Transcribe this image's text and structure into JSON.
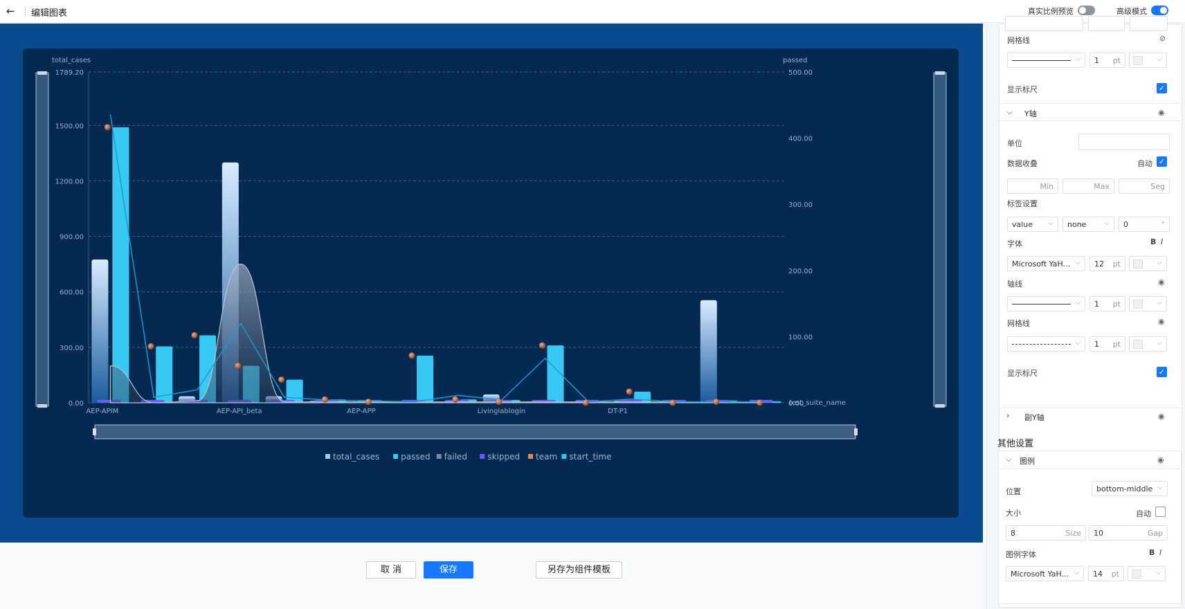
{
  "topbar": {
    "back_icon": "←",
    "title": "编辑图表",
    "real_ratio_label": "真实比例预览",
    "advanced_label": "高级模式",
    "real_ratio_on": false,
    "advanced_on": true
  },
  "chart_data": {
    "type": "bar",
    "categories": [
      "AEP-APIM",
      "",
      "",
      "AEP-API_beta",
      "",
      "",
      "AEP-APP",
      "",
      "",
      "Livinglablogin",
      "",
      "",
      "DT-P1",
      "",
      "",
      ""
    ],
    "x_tick_labels": [
      "AEP-APIM",
      "AEP-API_beta",
      "AEP-APP",
      "Livinglablogin",
      "DT-P1"
    ],
    "x_axis_name": "test_suite_name",
    "y_axis_name": "total_cases",
    "y2_axis_name": "passed",
    "ylim": [
      0,
      1789.2
    ],
    "y_ticks": [
      "0.00",
      "300.00",
      "600.00",
      "900.00",
      "1200.00",
      "1500.00",
      "1789.20"
    ],
    "y2lim": [
      0,
      500
    ],
    "y2_ticks": [
      "0.00",
      "100.00",
      "200.00",
      "300.00",
      "400.00",
      "500.00"
    ],
    "series": [
      {
        "name": "total_cases",
        "values": [
          775,
          0,
          35,
          1300,
          35,
          10,
          5,
          10,
          5,
          45,
          5,
          5,
          10,
          5,
          555,
          0
        ]
      },
      {
        "name": "passed",
        "values": [
          1490,
          305,
          365,
          200,
          125,
          18,
          5,
          255,
          18,
          15,
          310,
          5,
          60,
          5,
          12,
          8
        ]
      },
      {
        "name": "failed",
        "values": [
          200,
          0,
          10,
          750,
          5,
          5,
          5,
          5,
          5,
          5,
          5,
          5,
          5,
          5,
          5,
          5
        ]
      },
      {
        "name": "skipped",
        "values": [
          8,
          8,
          8,
          8,
          8,
          8,
          8,
          8,
          8,
          8,
          8,
          8,
          8,
          8,
          8,
          8
        ]
      },
      {
        "name": "team",
        "values": [
          1490,
          305,
          365,
          200,
          125,
          18,
          5,
          255,
          18,
          5,
          310,
          0,
          60,
          0,
          5,
          0
        ]
      },
      {
        "name": "start_time",
        "values": [
          1560,
          30,
          70,
          430,
          30,
          15,
          10,
          5,
          40,
          15,
          240,
          5,
          20,
          5,
          5,
          5
        ]
      }
    ],
    "legend": [
      "total_cases",
      "passed",
      "failed",
      "skipped",
      "team",
      "start_time"
    ],
    "legend_position": "bottom-middle",
    "legend_colors": [
      "#9ec9f0",
      "#38c8f4",
      "#7a8aa0",
      "#6b5cff",
      "#e0875a",
      "#33c2f0"
    ],
    "grid": true
  },
  "bottom": {
    "cancel": "取 消",
    "save": "保存",
    "save_template": "另存为组件模板"
  },
  "panel": {
    "gridline_label_top": "网格线",
    "line_width_top": "1",
    "unit_pt": "pt",
    "show_ruler_top": "显示标尺",
    "y_axis_title": "Y轴",
    "unit_label": "单位",
    "unit_value": "",
    "data_shrink_label": "数据收叠",
    "auto_label": "自动",
    "min_placeholder": "Min",
    "max_placeholder": "Max",
    "seg_placeholder": "Seg",
    "label_settings": "标签设置",
    "label_type": "value",
    "label_none": "none",
    "label_rotate": "0",
    "degree_unit": "°",
    "font_label": "字体",
    "bold_icon": "B",
    "italic_icon": "I",
    "font_name": "Microsoft YaH...",
    "font_size": "12",
    "axis_line_label": "轴线",
    "axis_line_width": "1",
    "gridline_label": "网格线",
    "gridline_width": "1",
    "show_ruler": "显示标尺",
    "sub_y_axis_title": "副Y轴",
    "other_settings": "其他设置",
    "legend_title": "图例",
    "position_label": "位置",
    "position_value": "bottom-middle",
    "size_label": "大小",
    "size_auto": "自动",
    "size_value": "8",
    "size_unit": "Size",
    "gap_value": "10",
    "gap_unit": "Gap",
    "legend_font_label": "图例字体",
    "legend_font_name": "Microsoft YaH...",
    "legend_font_size": "14"
  }
}
